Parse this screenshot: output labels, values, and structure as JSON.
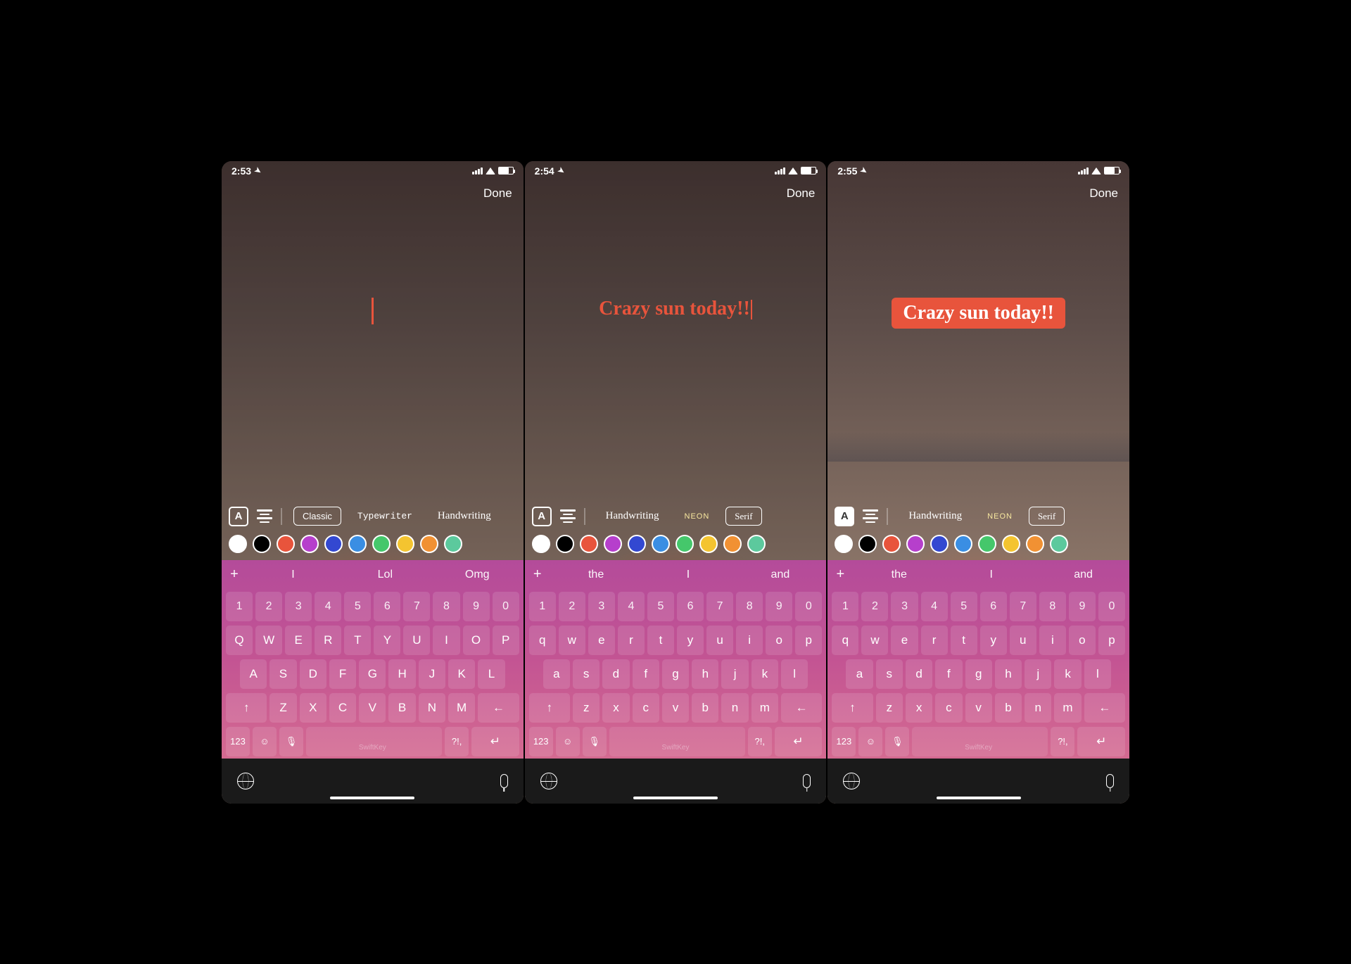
{
  "status": {
    "times": [
      "2:53",
      "2:54",
      "2:55"
    ]
  },
  "topbar": {
    "done": "Done"
  },
  "story": {
    "text": "Crazy sun today!!"
  },
  "fonts": {
    "classic": "Classic",
    "typewriter": "Typewriter",
    "handwriting": "Handwriting",
    "neon": "NEON",
    "serif": "Serif"
  },
  "a_icon": "A",
  "palette": [
    "#ffffff",
    "#000000",
    "#e8543c",
    "#b63fcc",
    "#3348d1",
    "#3a8ee3",
    "#45c76b",
    "#f4c430",
    "#f19133",
    "#5cc99d"
  ],
  "suggest": [
    {
      "plus": "+",
      "items": [
        "I",
        "Lol",
        "Omg"
      ]
    },
    {
      "plus": "+",
      "items": [
        "the",
        "I",
        "and"
      ]
    },
    {
      "plus": "+",
      "items": [
        "the",
        "I",
        "and"
      ]
    }
  ],
  "keys": {
    "nums": [
      "1",
      "2",
      "3",
      "4",
      "5",
      "6",
      "7",
      "8",
      "9",
      "0"
    ],
    "upper1": [
      "Q",
      "W",
      "E",
      "R",
      "T",
      "Y",
      "U",
      "I",
      "O",
      "P"
    ],
    "upper2": [
      "A",
      "S",
      "D",
      "F",
      "G",
      "H",
      "J",
      "K",
      "L"
    ],
    "upper3": [
      "Z",
      "X",
      "C",
      "V",
      "B",
      "N",
      "M"
    ],
    "lower1": [
      "q",
      "w",
      "e",
      "r",
      "t",
      "y",
      "u",
      "i",
      "o",
      "p"
    ],
    "lower2": [
      "a",
      "s",
      "d",
      "f",
      "g",
      "h",
      "j",
      "k",
      "l"
    ],
    "lower3": [
      "z",
      "x",
      "c",
      "v",
      "b",
      "n",
      "m"
    ],
    "shift": "↑",
    "back": "←",
    "num": "123",
    "emoji": "☺",
    "mic": "🎤",
    "punc": "?!,",
    "enter": "↵"
  },
  "brand": "SwiftKey"
}
